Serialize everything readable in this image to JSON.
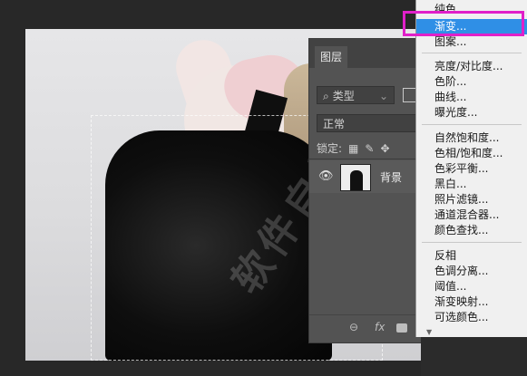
{
  "layers_panel": {
    "tab_label": "图层",
    "filter_kind": "类型",
    "blend_mode": "正常",
    "lock_label": "锁定:",
    "layer_name": "背景"
  },
  "watermark": "软件自学网",
  "adjustment_menu": {
    "groups": [
      [
        "纯色...",
        "渐变...",
        "图案..."
      ],
      [
        "亮度/对比度...",
        "色阶...",
        "曲线...",
        "曝光度..."
      ],
      [
        "自然饱和度...",
        "色相/饱和度...",
        "色彩平衡...",
        "黑白...",
        "照片滤镜...",
        "通道混合器...",
        "颜色查找..."
      ],
      [
        "反相",
        "色调分离...",
        "阈值...",
        "渐变映射...",
        "可选颜色..."
      ]
    ],
    "active_item": "渐变..."
  },
  "colors": {
    "highlight": "#e020c9",
    "menu_active": "#2f8fe6"
  }
}
